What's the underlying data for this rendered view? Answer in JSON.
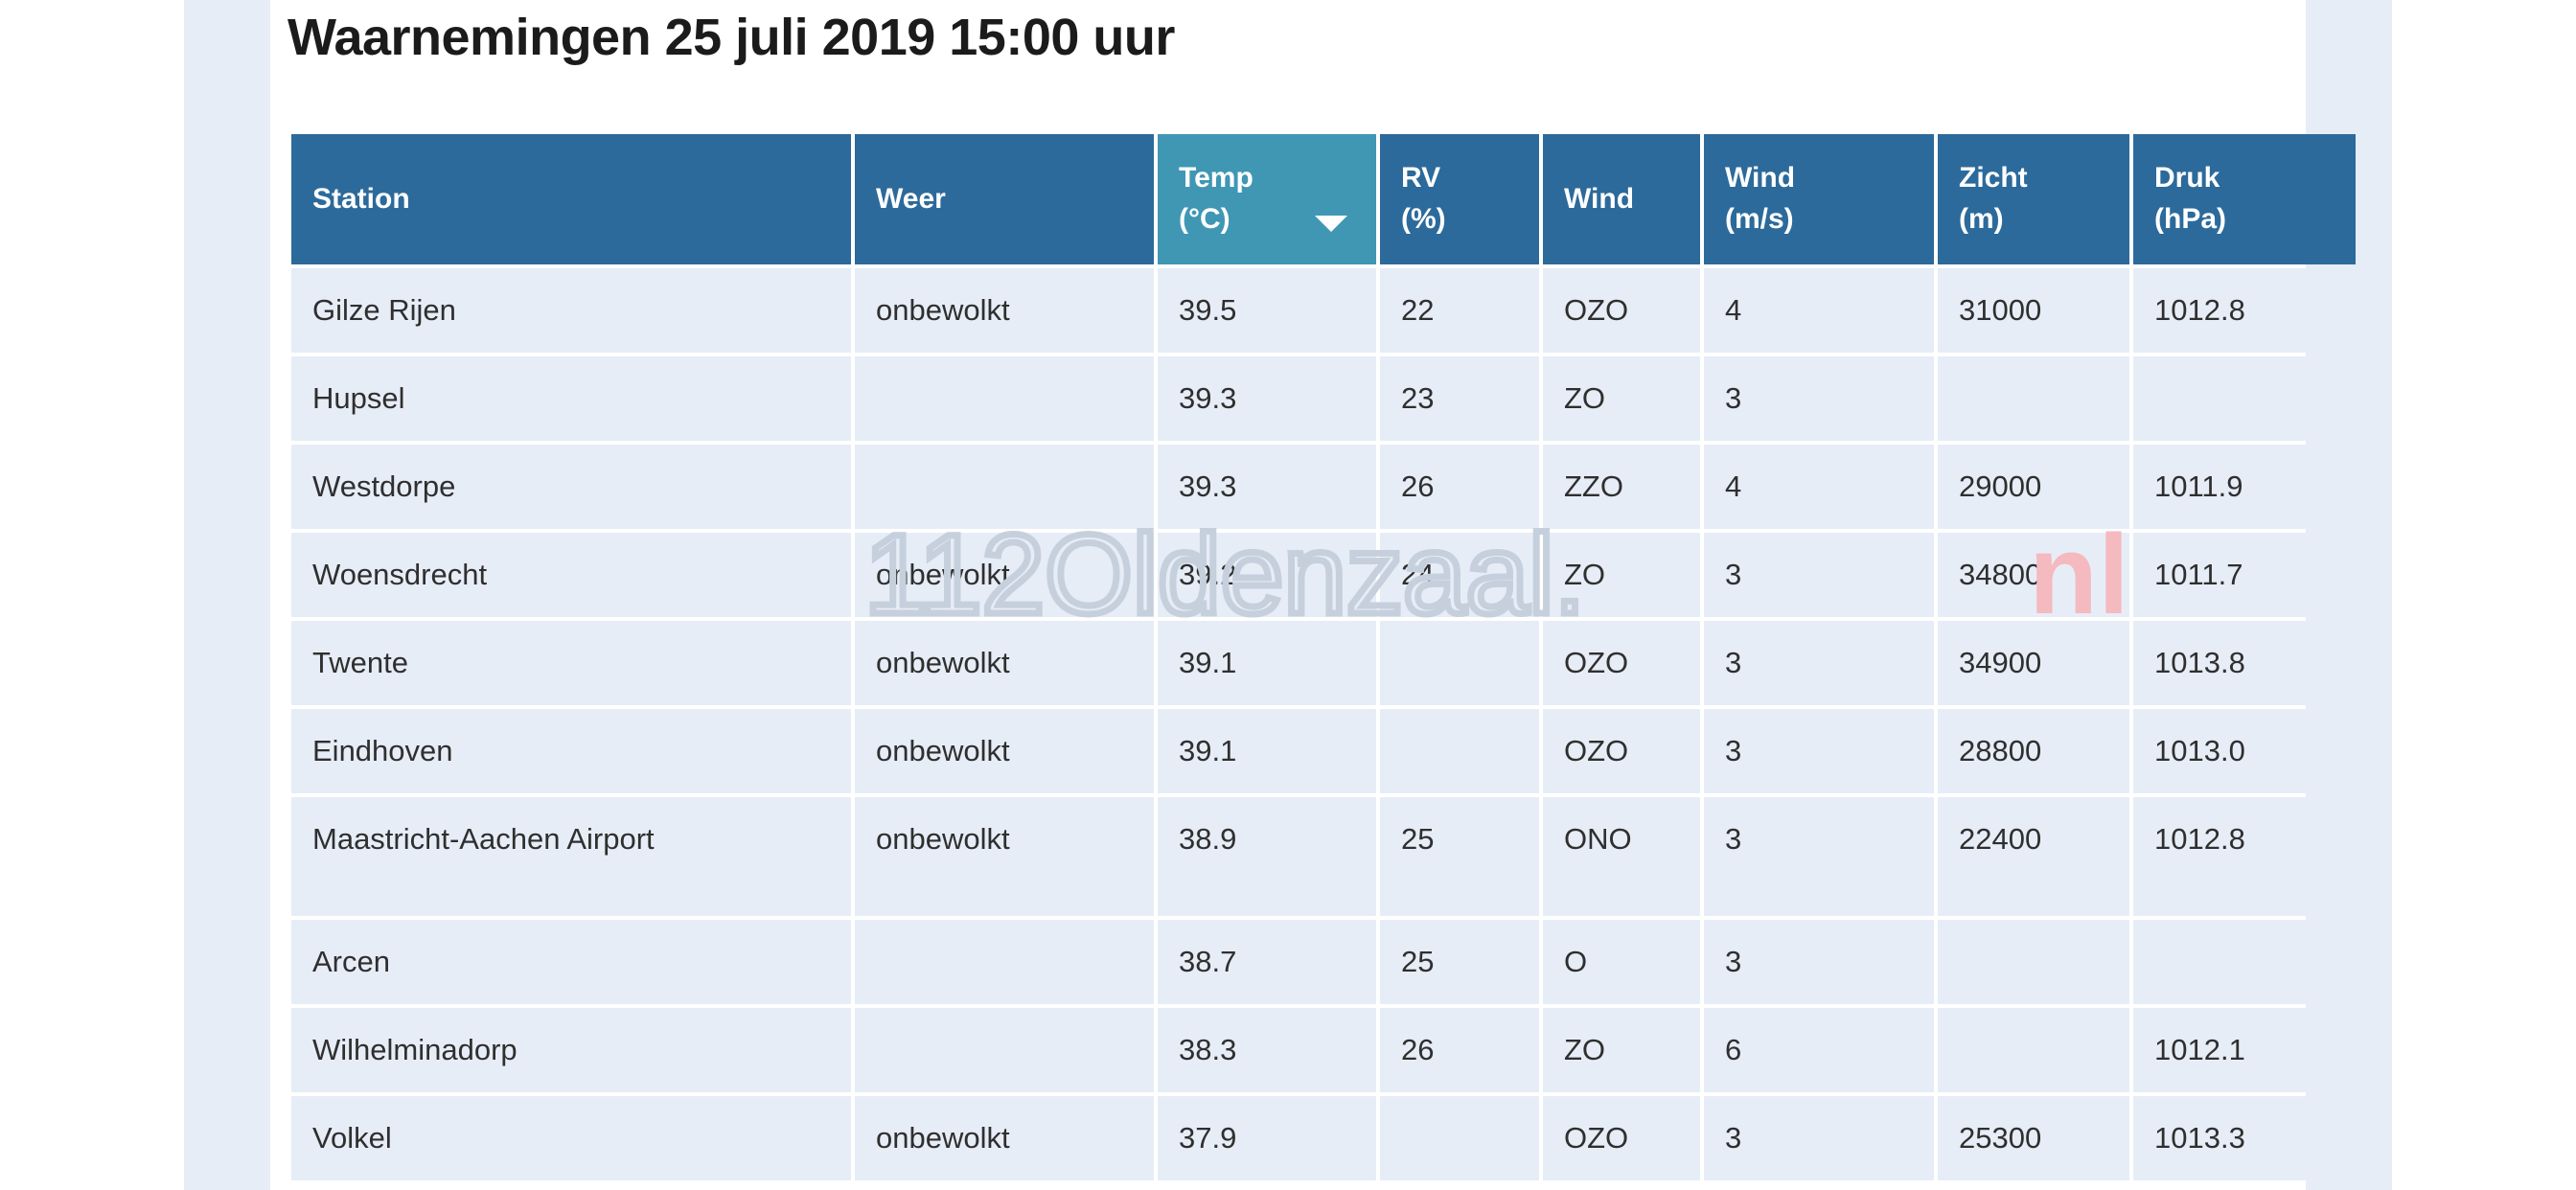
{
  "page": {
    "title": "Waarnemingen 25 juli 2019 15:00 uur",
    "background_color": "#ffffff",
    "side_band_color": "#e6edf7"
  },
  "watermark": {
    "text": "112Oldenzaal.nl",
    "main_part": "112Oldenzaal.",
    "accent_part": "nl",
    "accent_color": "#f3b8bd",
    "base_color": "#c9d2de"
  },
  "table": {
    "header_color": "#2c6a9b",
    "sorted_header_color": "#3f97b4",
    "row_color": "#e7edf7",
    "sorted_column_key": "temp",
    "sort_direction": "descending",
    "sort_icon": "chevron-down-icon",
    "columns": [
      {
        "key": "station",
        "line1": "Station",
        "line2": "",
        "sorted": false
      },
      {
        "key": "weer",
        "line1": "Weer",
        "line2": "",
        "sorted": false
      },
      {
        "key": "temp",
        "line1": "Temp",
        "line2": "(°C)",
        "sorted": true
      },
      {
        "key": "rv",
        "line1": "RV",
        "line2": "(%)",
        "sorted": false
      },
      {
        "key": "wind",
        "line1": "Wind",
        "line2": "",
        "sorted": false
      },
      {
        "key": "windms",
        "line1": "Wind",
        "line2": "(m/s)",
        "sorted": false
      },
      {
        "key": "zicht",
        "line1": "Zicht",
        "line2": "(m)",
        "sorted": false
      },
      {
        "key": "druk",
        "line1": "Druk",
        "line2": "(hPa)",
        "sorted": false
      }
    ],
    "rows": [
      {
        "station": "Gilze Rijen",
        "weer": "onbewolkt",
        "temp": "39.5",
        "rv": "22",
        "wind": "OZO",
        "windms": "4",
        "zicht": "31000",
        "druk": "1012.8"
      },
      {
        "station": "Hupsel",
        "weer": "",
        "temp": "39.3",
        "rv": "23",
        "wind": "ZO",
        "windms": "3",
        "zicht": "",
        "druk": ""
      },
      {
        "station": "Westdorpe",
        "weer": "",
        "temp": "39.3",
        "rv": "26",
        "wind": "ZZO",
        "windms": "4",
        "zicht": "29000",
        "druk": "1011.9"
      },
      {
        "station": "Woensdrecht",
        "weer": "onbewolkt",
        "temp": "39.2",
        "rv": "24",
        "wind": "ZO",
        "windms": "3",
        "zicht": "34800",
        "druk": "1011.7"
      },
      {
        "station": "Twente",
        "weer": "onbewolkt",
        "temp": "39.1",
        "rv": "",
        "wind": "OZO",
        "windms": "3",
        "zicht": "34900",
        "druk": "1013.8"
      },
      {
        "station": "Eindhoven",
        "weer": "onbewolkt",
        "temp": "39.1",
        "rv": "",
        "wind": "OZO",
        "windms": "3",
        "zicht": "28800",
        "druk": "1013.0"
      },
      {
        "station": "Maastricht-Aachen Airport",
        "weer": "onbewolkt",
        "temp": "38.9",
        "rv": "25",
        "wind": "ONO",
        "windms": "3",
        "zicht": "22400",
        "druk": "1012.8"
      },
      {
        "station": "Arcen",
        "weer": "",
        "temp": "38.7",
        "rv": "25",
        "wind": "O",
        "windms": "3",
        "zicht": "",
        "druk": ""
      },
      {
        "station": "Wilhelminadorp",
        "weer": "",
        "temp": "38.3",
        "rv": "26",
        "wind": "ZO",
        "windms": "6",
        "zicht": "",
        "druk": "1012.1"
      },
      {
        "station": "Volkel",
        "weer": "onbewolkt",
        "temp": "37.9",
        "rv": "",
        "wind": "OZO",
        "windms": "3",
        "zicht": "25300",
        "druk": "1013.3"
      }
    ]
  }
}
